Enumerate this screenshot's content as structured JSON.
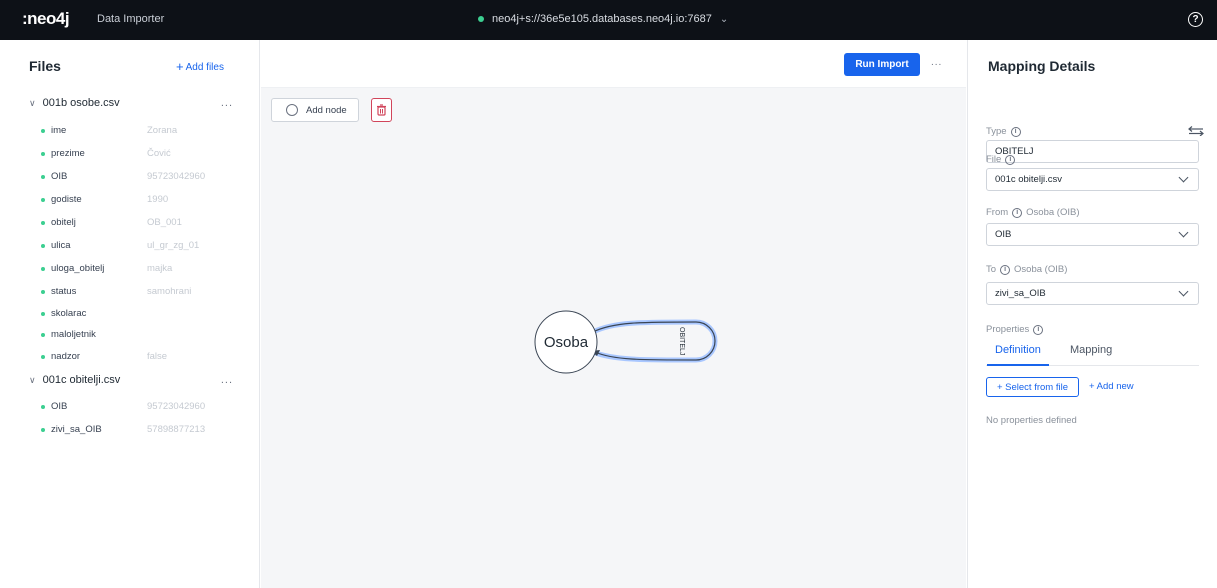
{
  "topbar": {
    "logo": ":neo4j",
    "app_title": "Data Importer",
    "connection": "neo4j+s://36e5e105.databases.neo4j.io:7687",
    "status_color": "#3ccf91",
    "help_icon": "question-circle-icon"
  },
  "files": {
    "title": "Files",
    "add_files_label": "Add files",
    "file1": {
      "name": "001b osobe.csv",
      "more": "...",
      "fields": [
        {
          "name": "ime",
          "value": "Zorana"
        },
        {
          "name": "prezime",
          "value": "Čović"
        },
        {
          "name": "OIB",
          "value": "95723042960"
        },
        {
          "name": "godiste",
          "value": "1990"
        },
        {
          "name": "obitelj",
          "value": "OB_001"
        },
        {
          "name": "ulica",
          "value": "ul_gr_zg_01"
        },
        {
          "name": "uloga_obitelj",
          "value": "majka"
        },
        {
          "name": "status",
          "value": "samohrani"
        },
        {
          "name": "skolarac",
          "value": ""
        },
        {
          "name": "maloljetnik",
          "value": ""
        },
        {
          "name": "nadzor",
          "value": "false"
        }
      ]
    },
    "file2": {
      "name": "001c obitelji.csv",
      "more": "...",
      "fields": [
        {
          "name": "OIB",
          "value": "95723042960"
        },
        {
          "name": "zivi_sa_OIB",
          "value": "57898877213"
        }
      ]
    }
  },
  "canvas": {
    "run_import_label": "Run Import",
    "more": "...",
    "add_node_label": "Add node",
    "node_label": "Osoba",
    "relationship_label": "OBITELJ",
    "accent": "#1864ec"
  },
  "mapping": {
    "title": "Mapping Details",
    "type_label": "Type",
    "type_value": "OBITELJ",
    "file_label": "File",
    "file_value": "001c obitelji.csv",
    "from_label": "From",
    "from_node": "Osoba (OIB)",
    "from_value": "OIB",
    "to_label": "To",
    "to_node": "Osoba (OIB)",
    "to_value": "zivi_sa_OIB",
    "properties_label": "Properties",
    "tab_definition": "Definition",
    "tab_mapping": "Mapping",
    "select_from_file": "+ Select from file",
    "add_new": "+ Add new",
    "no_properties": "No properties defined"
  }
}
